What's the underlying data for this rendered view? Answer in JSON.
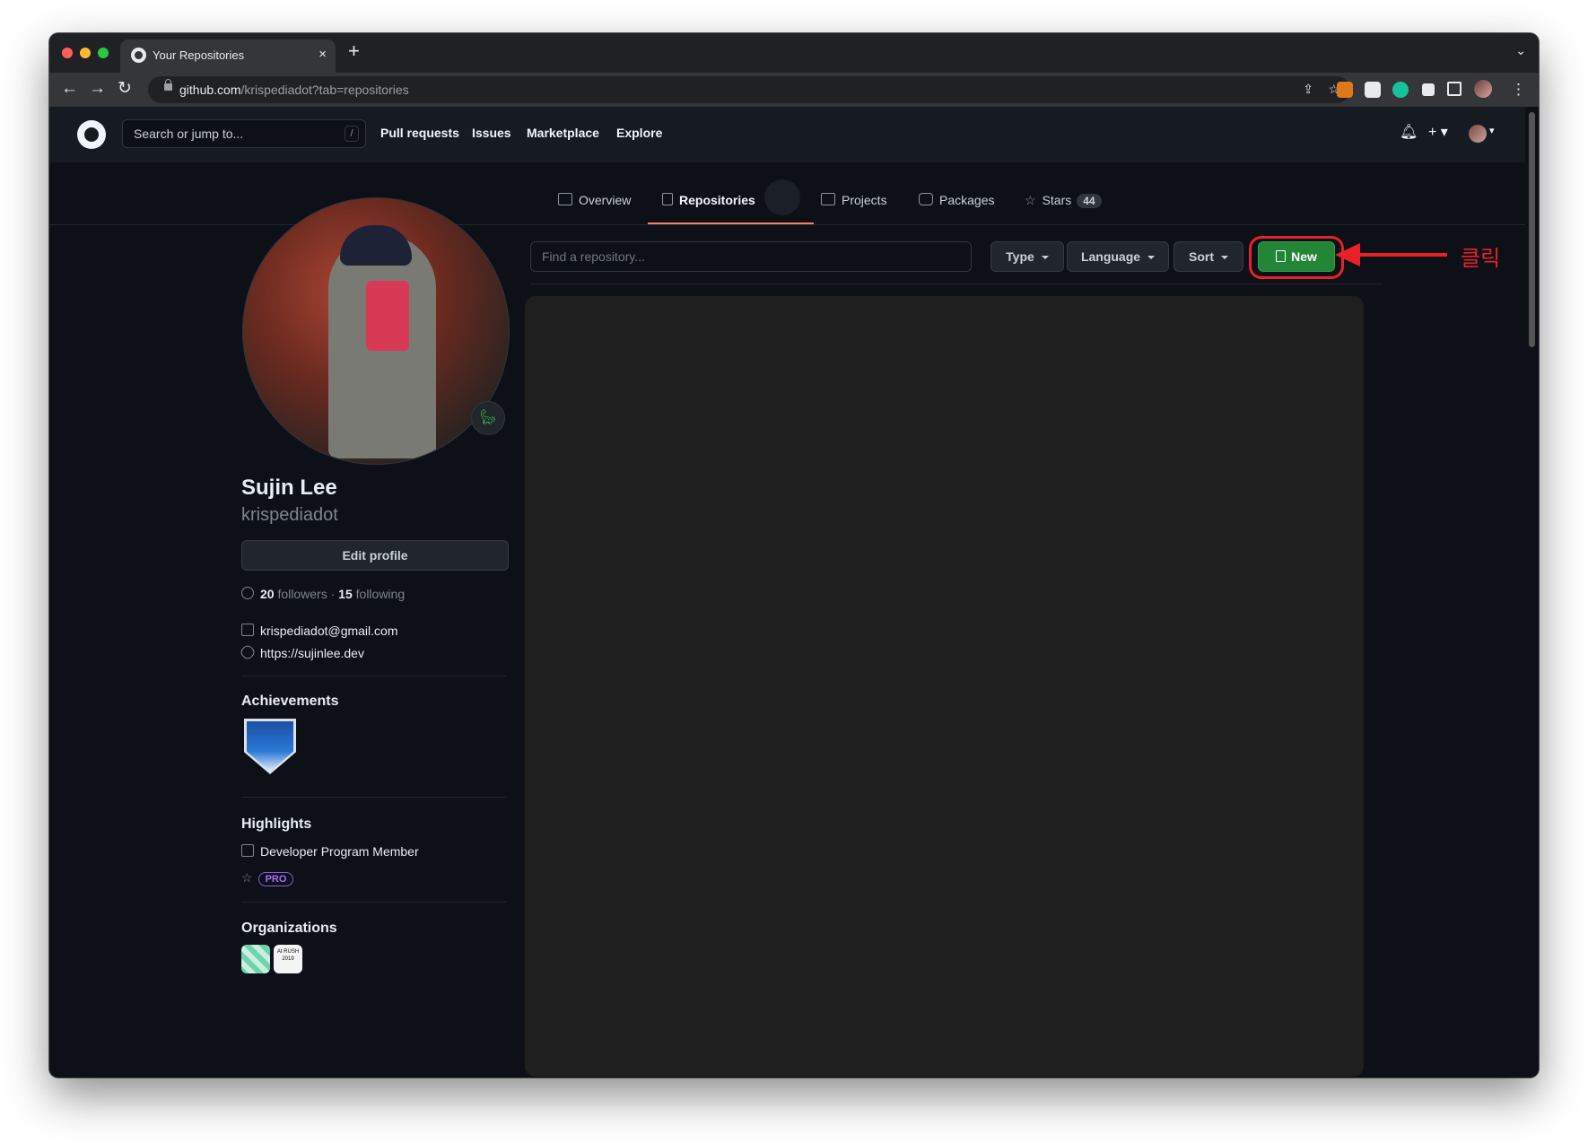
{
  "browser": {
    "tab_title": "Your Repositories",
    "tab_close": "×",
    "new_tab": "+",
    "tab_list": "⌄",
    "url_host": "github.com",
    "url_rest": "/krispediadot?tab=repositories",
    "back": "←",
    "forward": "→",
    "reload": "↻",
    "share": "⇪",
    "bookmark": "☆",
    "menu": "⋮"
  },
  "header": {
    "search_placeholder": "Search or jump to...",
    "search_shortcut": "/",
    "nav": [
      "Pull requests",
      "Issues",
      "Marketplace",
      "Explore"
    ],
    "bell": "🔔︎",
    "plus": "+ ▾",
    "avatar_caret": "▾"
  },
  "profile_tabs": {
    "overview": "Overview",
    "repositories": "Repositories",
    "projects": "Projects",
    "packages": "Packages",
    "stars": "Stars",
    "stars_count": "44"
  },
  "profile": {
    "emoji": "🦕︎",
    "name": "Sujin Lee",
    "login": "krispediadot",
    "edit_profile": "Edit profile",
    "followers_count": "20",
    "followers_label": "followers",
    "separator": "·",
    "following_count": "15",
    "following_label": "following",
    "email": "krispediadot@gmail.com",
    "website": "https://sujinlee.dev"
  },
  "achievements": {
    "title": "Achievements"
  },
  "highlights": {
    "title": "Highlights",
    "developer": "Developer Program Member",
    "pro": "PRO"
  },
  "organizations": {
    "title": "Organizations",
    "org2_text": "AI RUSH 2019"
  },
  "repo_controls": {
    "find_placeholder": "Find a repository...",
    "type": "Type",
    "language": "Language",
    "sort": "Sort",
    "new": "New"
  },
  "annotation": {
    "text": "클릭"
  },
  "colors": {
    "page_bg": "#0d1117",
    "header_bg": "#161b22",
    "accent_tab": "#f78166",
    "new_button": "#238636",
    "annotation": "#e8202a"
  },
  "icons": [
    "github-logo-icon",
    "book-icon",
    "repo-icon",
    "project-icon",
    "package-icon",
    "star-icon",
    "people-icon",
    "mail-icon",
    "link-icon",
    "cpu-icon",
    "bell-icon",
    "plus-icon"
  ]
}
